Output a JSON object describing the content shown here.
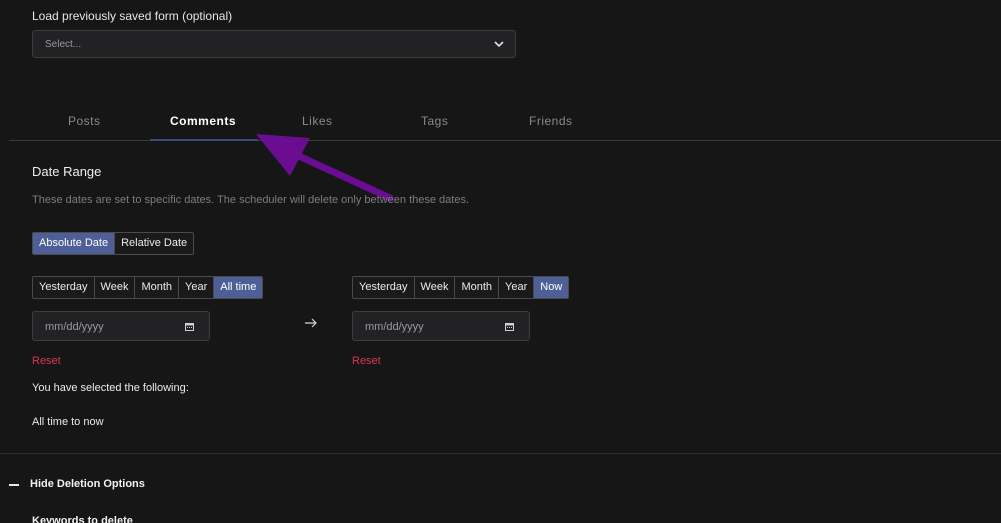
{
  "load_form": {
    "label": "Load previously saved form (optional)",
    "placeholder": "Select..."
  },
  "tabs": [
    {
      "label": "Posts",
      "active": false
    },
    {
      "label": "Comments",
      "active": true
    },
    {
      "label": "Likes",
      "active": false
    },
    {
      "label": "Tags",
      "active": false
    },
    {
      "label": "Friends",
      "active": false
    }
  ],
  "date_range": {
    "title": "Date Range",
    "description": "These dates are set to specific dates. The scheduler will delete only between these dates.",
    "mode_options": [
      "Absolute Date",
      "Relative Date"
    ],
    "mode_selected": "Absolute Date",
    "start": {
      "presets": [
        "Yesterday",
        "Week",
        "Month",
        "Year",
        "All time"
      ],
      "selected": "All time",
      "placeholder": "mm/dd/yyyy",
      "reset_label": "Reset"
    },
    "end": {
      "presets": [
        "Yesterday",
        "Week",
        "Month",
        "Year",
        "Now"
      ],
      "selected": "Now",
      "placeholder": "mm/dd/yyyy",
      "reset_label": "Reset"
    },
    "selection_label": "You have selected the following:",
    "selection_value": "All time to now"
  },
  "deletion_options": {
    "toggle_label": "Hide Deletion Options",
    "keywords_label": "Keywords to delete"
  },
  "colors": {
    "background": "#161616",
    "accent": "#4e5f98",
    "reset": "#d6365a",
    "annotation_arrow": "#6a0d91"
  }
}
